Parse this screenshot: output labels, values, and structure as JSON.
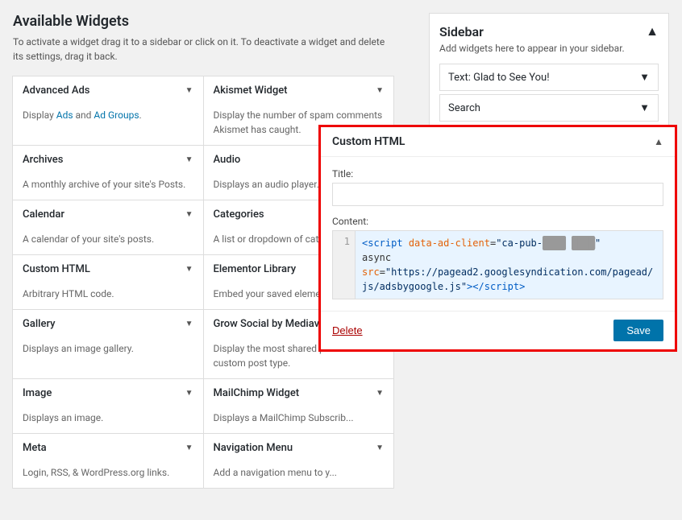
{
  "page": {
    "available_widgets_title": "Available Widgets",
    "available_widgets_desc": "To activate a widget drag it to a sidebar or click on it. To deactivate a widget and delete its settings, drag it back.",
    "widgets": [
      {
        "name": "Advanced Ads",
        "desc": "Display Ads and Ad Groups.",
        "col": 0
      },
      {
        "name": "Akismet Widget",
        "desc": "Display the number of spam comments Akismet has caught.",
        "col": 1
      },
      {
        "name": "Archives",
        "desc": "A monthly archive of your site's Posts.",
        "col": 0
      },
      {
        "name": "Audio",
        "desc": "Displays an audio player.",
        "col": 1
      },
      {
        "name": "Calendar",
        "desc": "A calendar of your site's posts.",
        "col": 0
      },
      {
        "name": "Categories",
        "desc": "A list or dropdown of categories.",
        "col": 1
      },
      {
        "name": "Custom HTML",
        "desc": "Arbitrary HTML code.",
        "col": 0
      },
      {
        "name": "Elementor Library",
        "desc": "Embed your saved elements.",
        "col": 1
      },
      {
        "name": "Gallery",
        "desc": "Displays an image gallery.",
        "col": 0
      },
      {
        "name": "Grow Social by Mediavine ...",
        "desc": "Display the most shared posts for custom post type.",
        "col": 1
      },
      {
        "name": "Image",
        "desc": "Displays an image.",
        "col": 0
      },
      {
        "name": "MailChimp Widget",
        "desc": "Displays a MailChimp Subscribe.",
        "col": 1
      },
      {
        "name": "Meta",
        "desc": "Login, RSS, & WordPress.org links.",
        "col": 0
      },
      {
        "name": "Navigation Menu",
        "desc": "Add a navigation menu to your sidebar.",
        "col": 1
      }
    ]
  },
  "sidebar": {
    "title": "Sidebar",
    "up_arrow": "▲",
    "desc": "Add widgets here to appear in your sidebar.",
    "widgets": [
      {
        "name": "Text: Glad to See You!"
      },
      {
        "name": "Search"
      }
    ]
  },
  "custom_html_panel": {
    "title": "Custom HTML",
    "title_label": "Title:",
    "title_placeholder": "",
    "content_label": "Content:",
    "code_line": "1",
    "code_text": "<script data-ad-client=\"ca-pub-████ ████\nasync\nsrc=\"https://pagead2.googlesyndication.com/pagead/js/adsbygoogle.js\"></script>",
    "delete_label": "Delete",
    "save_label": "Save"
  },
  "icons": {
    "chevron_down": "▼",
    "chevron_up": "▲"
  }
}
